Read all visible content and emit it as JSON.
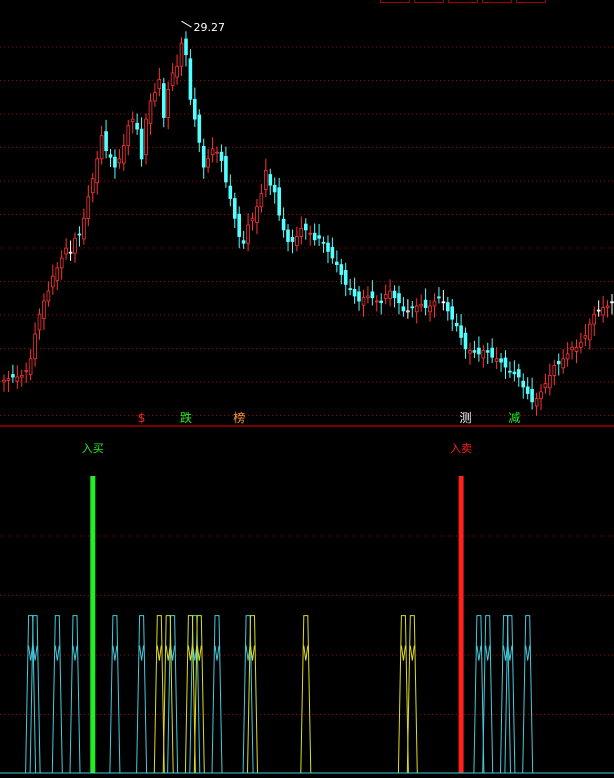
{
  "toolbar": {
    "buttons": [
      "",
      "",
      "",
      "",
      ""
    ]
  },
  "chart_data": [
    {
      "type": "candlestick",
      "title": "",
      "colors": {
        "up": "#ff3333",
        "down": "#54ffff",
        "flat": "#ffffff",
        "grid": "#a00000",
        "annotation": "#ffffff"
      },
      "ylim": [
        5.8,
        30.0
      ],
      "max_label": "29.27",
      "max_index": 40,
      "closes": [
        8.2,
        8.3,
        8.4,
        8.4,
        8.5,
        8.8,
        9.5,
        11.0,
        12.2,
        13.0,
        13.6,
        14.5,
        15.0,
        15.6,
        16.2,
        15.9,
        16.8,
        17.0,
        18.0,
        19.3,
        20.4,
        21.6,
        23.0,
        22.1,
        21.7,
        21.1,
        21.6,
        22.4,
        23.6,
        24.0,
        23.4,
        21.6,
        24.0,
        25.1,
        25.6,
        26.4,
        24.1,
        25.8,
        26.8,
        27.2,
        28.6,
        27.9,
        25.2,
        24.0,
        22.6,
        21.1,
        21.6,
        22.2,
        22.0,
        21.5,
        20.2,
        19.2,
        18.0,
        16.9,
        16.5,
        17.6,
        18.0,
        18.7,
        19.5,
        20.9,
        20.0,
        19.6,
        18.2,
        17.3,
        16.6,
        16.6,
        16.9,
        17.4,
        17.3,
        17.1,
        16.7,
        16.8,
        16.5,
        16.0,
        15.6,
        15.2,
        14.6,
        14.0,
        13.7,
        13.3,
        13.0,
        13.2,
        13.3,
        13.2,
        13.0,
        12.9,
        13.4,
        13.6,
        13.2,
        12.9,
        12.4,
        12.4,
        12.6,
        12.7,
        12.8,
        12.6,
        12.7,
        13.0,
        13.2,
        12.9,
        12.4,
        11.9,
        11.5,
        10.8,
        10.1,
        10.0,
        9.9,
        9.8,
        10.0,
        9.9,
        9.6,
        9.5,
        9.3,
        9.0,
        8.7,
        8.6,
        8.4,
        7.8,
        7.4,
        6.9,
        7.1,
        7.5,
        8.0,
        8.5,
        9.1,
        9.2,
        9.5,
        9.8,
        10.2,
        10.2,
        10.5,
        10.9,
        11.6,
        12.2,
        12.4,
        12.6,
        12.7,
        12.9
      ]
    },
    {
      "type": "bar",
      "title": "",
      "ylim": [
        0,
        1
      ],
      "signals": [
        {
          "label": "入买",
          "index": 20,
          "color": "#22ee22"
        },
        {
          "label": "入卖",
          "index": 103,
          "color": "#ff2020"
        }
      ],
      "markers": [
        {
          "label": "$",
          "index": 31,
          "color": "#ff2020"
        },
        {
          "label": "跌",
          "index": 41,
          "color": "#22ee22"
        },
        {
          "label": "榜",
          "index": 53,
          "color": "#ff9933"
        },
        {
          "label": "测",
          "index": 104,
          "color": "#ffffff"
        },
        {
          "label": "减",
          "index": 115,
          "color": "#22ee22"
        }
      ],
      "spike_series": [
        {
          "name": "",
          "color": "#44ccdd",
          "indices": [
            6,
            7,
            12,
            16,
            25,
            31,
            38,
            43,
            48,
            55,
            107,
            109,
            113,
            114,
            118
          ]
        },
        {
          "name": "",
          "color": "#dddd22",
          "indices": [
            35,
            37,
            42,
            44,
            56,
            68,
            90,
            92
          ]
        }
      ],
      "spike_level": 0.53
    }
  ]
}
